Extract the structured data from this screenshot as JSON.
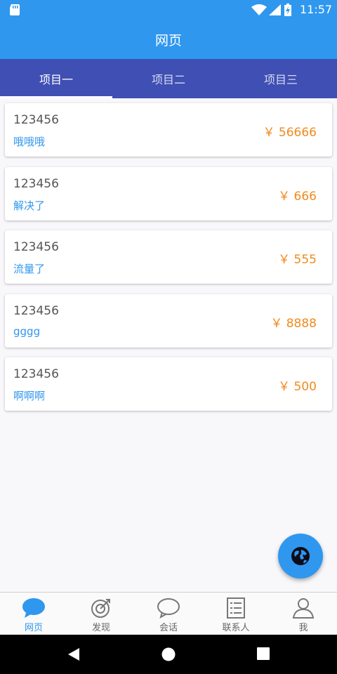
{
  "status_bar": {
    "time": "11:57"
  },
  "app_bar": {
    "title": "网页"
  },
  "tabs": [
    {
      "label": "项目一",
      "active": true
    },
    {
      "label": "项目二",
      "active": false
    },
    {
      "label": "项目三",
      "active": false
    }
  ],
  "items": [
    {
      "code": "123456",
      "subtitle": "哦哦哦",
      "price": "￥ 56666"
    },
    {
      "code": "123456",
      "subtitle": "解决了",
      "price": "￥ 666"
    },
    {
      "code": "123456",
      "subtitle": "流量了",
      "price": "￥ 555"
    },
    {
      "code": "123456",
      "subtitle": "gggg",
      "price": "￥ 8888"
    },
    {
      "code": "123456",
      "subtitle": "啊啊啊",
      "price": "￥ 500"
    }
  ],
  "fab": {
    "icon": "globe-icon"
  },
  "bottom_nav": [
    {
      "label": "网页",
      "icon": "chat-bubble-icon",
      "active": true
    },
    {
      "label": "发现",
      "icon": "discover-icon",
      "active": false
    },
    {
      "label": "会话",
      "icon": "conversation-icon",
      "active": false
    },
    {
      "label": "联系人",
      "icon": "contacts-icon",
      "active": false
    },
    {
      "label": "我",
      "icon": "person-icon",
      "active": false
    }
  ],
  "colors": {
    "primary": "#2f97ee",
    "tab_bar": "#3f4fb3",
    "price": "#f08a1e",
    "subtitle": "#2f97ee"
  }
}
